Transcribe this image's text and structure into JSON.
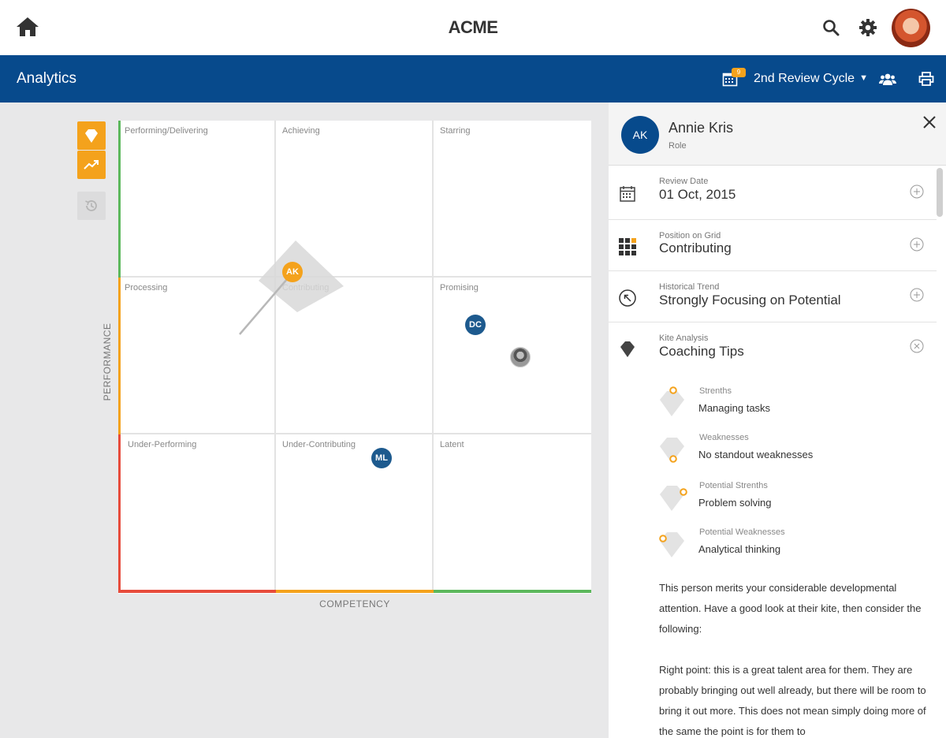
{
  "app": {
    "brand": "ACME"
  },
  "header": {
    "title": "Analytics",
    "calendar_badge": "9",
    "cycle_label": "2nd Review Cycle"
  },
  "icons": {
    "home": "home-icon",
    "search": "search-icon",
    "settings": "gear-icon",
    "calendar": "calendar-icon",
    "team": "users-icon",
    "print": "printer-icon"
  },
  "tools": [
    "kite-icon",
    "trend-icon",
    "history-icon"
  ],
  "grid": {
    "y_axis": "PERFORMANCE",
    "x_axis": "COMPETENCY",
    "cells": [
      [
        "Performing/Delivering",
        "Achieving",
        "Starring"
      ],
      [
        "Processing",
        "Contributing",
        "Promising"
      ],
      [
        "Under-Performing",
        "Under-Contributing",
        "Latent"
      ]
    ],
    "markers": [
      {
        "initials": "AK",
        "style": "orange"
      },
      {
        "initials": "DC",
        "style": "blue"
      },
      {
        "initials": "ML",
        "style": "blue"
      },
      {
        "initials": "",
        "style": "photo"
      }
    ],
    "colors": {
      "green": "#5cb85c",
      "orange": "#f4a21c",
      "red": "#e74c3c",
      "navy": "#074a8c"
    }
  },
  "panel": {
    "initials": "AK",
    "name": "Annie Kris",
    "role": "Role",
    "review_date": {
      "label": "Review Date",
      "value": "01 Oct, 2015"
    },
    "position": {
      "label": "Position on Grid",
      "value": "Contributing"
    },
    "trend": {
      "label": "Historical Trend",
      "value": "Strongly Focusing on Potential"
    },
    "kite": {
      "label": "Kite Analysis",
      "value": "Coaching Tips"
    },
    "tips": [
      {
        "label": "Strenths",
        "value": "Managing tasks"
      },
      {
        "label": "Weaknesses",
        "value": "No standout weaknesses"
      },
      {
        "label": "Potential Strenths",
        "value": "Problem solving"
      },
      {
        "label": "Potential Weaknesses",
        "value": "Analytical thinking"
      }
    ],
    "paragraph1": "This person merits your considerable developmental attention. Have a good look at their kite, then consider the following:",
    "paragraph2": "Right point: this is a great talent area for them. They are probably bringing out well already, but there will be room to bring it out more. This does not mean simply doing more of the same  the point is for them to"
  }
}
